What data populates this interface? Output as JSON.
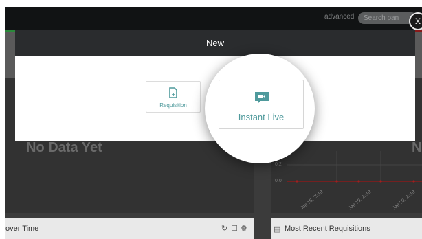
{
  "topbar": {
    "advanced_label": "advanced",
    "search_placeholder": "Search pan"
  },
  "modal": {
    "title": "New",
    "options": [
      {
        "label": "Requisition",
        "icon": "document-plus-icon"
      },
      {
        "label": "Instant Live",
        "icon": "video-chat-icon"
      }
    ],
    "close_label": "X"
  },
  "left_panel": {
    "empty_text": "No Data Yet",
    "footer_title": "over Time"
  },
  "right_panel": {
    "empty_text": "N",
    "footer_title": "Most Recent Requisitions",
    "y_ticks": [
      "0.2",
      "0.0"
    ],
    "x_ticks": [
      "Jan 18, 2018",
      "Jan 19, 2018",
      "Jan 20, 2018"
    ]
  },
  "colors": {
    "accent_teal": "#4f9a9c",
    "modal_header": "#2a2c2e",
    "overlay": "#3b3b3b"
  }
}
